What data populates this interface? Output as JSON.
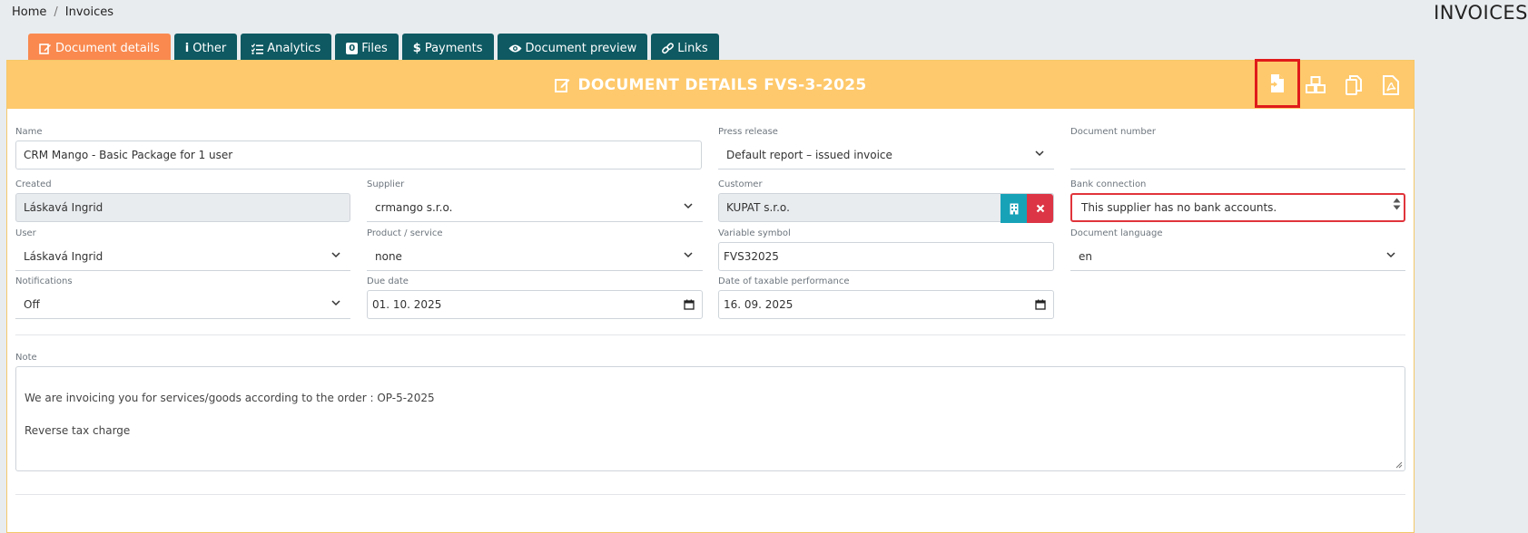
{
  "breadcrumb": {
    "home": "Home",
    "separator": "/",
    "current": "Invoices"
  },
  "page_heading": "INVOICES",
  "tabs": [
    {
      "label": "Document details",
      "icon": "edit-icon"
    },
    {
      "label": "Other",
      "icon": "info-icon"
    },
    {
      "label": "Analytics",
      "icon": "list-check-icon"
    },
    {
      "label": "Files",
      "icon": "files-badge-icon",
      "badge": "0"
    },
    {
      "label": "Payments",
      "icon": "dollar-icon"
    },
    {
      "label": "Document preview",
      "icon": "eye-icon"
    },
    {
      "label": "Links",
      "icon": "link-icon"
    }
  ],
  "panel": {
    "title": "DOCUMENT DETAILS FVS-3-2025",
    "header_color": "#fec96c",
    "actions": [
      "file-import-icon",
      "cubes-icon",
      "copy-icon",
      "file-pdf-icon"
    ]
  },
  "form": {
    "name": {
      "label": "Name",
      "value": "CRM Mango - Basic Package for 1 user"
    },
    "press_release": {
      "label": "Press release",
      "value": "Default report – issued invoice"
    },
    "document_number": {
      "label": "Document number",
      "value": ""
    },
    "created": {
      "label": "Created",
      "value": "Láskavá Ingrid"
    },
    "supplier": {
      "label": "Supplier",
      "value": "crmango s.r.o."
    },
    "customer": {
      "label": "Customer",
      "value": "KUPAT s.r.o."
    },
    "bank_connection": {
      "label": "Bank connection",
      "value": "This supplier has no bank accounts."
    },
    "user": {
      "label": "User",
      "value": "Láskavá Ingrid"
    },
    "product": {
      "label": "Product / service",
      "value": "none"
    },
    "variable_symbol": {
      "label": "Variable symbol",
      "value": "FVS32025"
    },
    "document_language": {
      "label": "Document language",
      "value": "en"
    },
    "notifications": {
      "label": "Notifications",
      "value": "Off"
    },
    "due_date": {
      "label": "Due date",
      "value": "01. 10. 2025"
    },
    "taxable_date": {
      "label": "Date of taxable performance",
      "value": "16. 09. 2025"
    },
    "note": {
      "label": "Note",
      "value": "We are invoicing you for services/goods according to the order : OP-5-2025\n\nReverse tax charge"
    }
  },
  "colors": {
    "tab_active": "#f9894f",
    "tab": "#0e5962",
    "highlight": "#e01b1b",
    "error": "#e0343b",
    "info": "#17a2b8",
    "danger": "#dc3545"
  }
}
